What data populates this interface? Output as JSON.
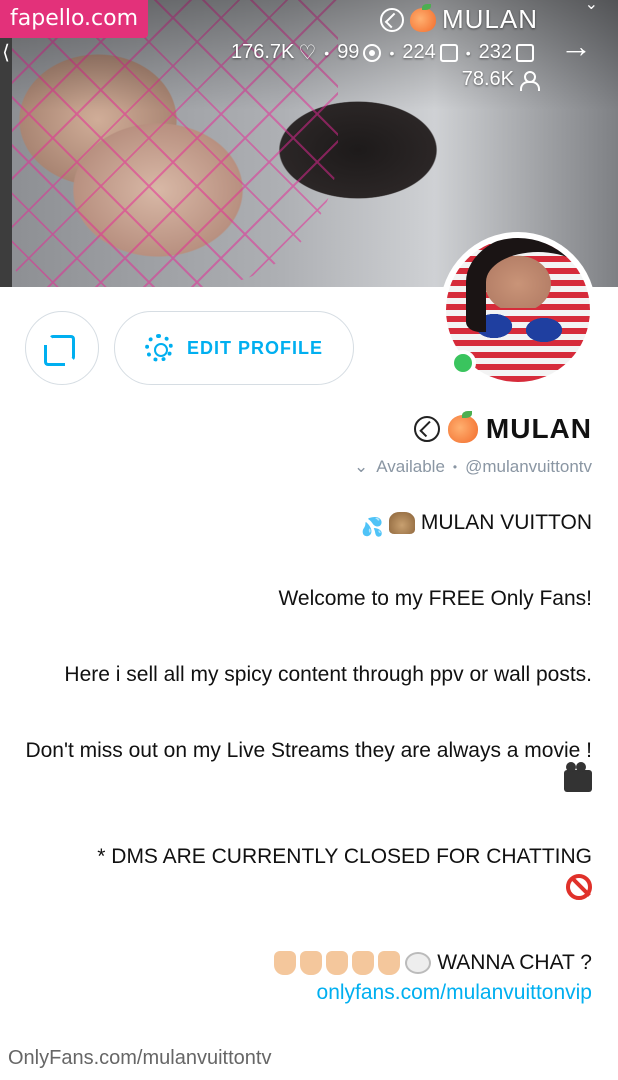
{
  "watermark": "fapello.com",
  "header": {
    "name": "MULAN",
    "stats": {
      "photos": "232",
      "videos": "224",
      "streams": "99",
      "likes": "176.7K"
    },
    "fans": "78.6K"
  },
  "actions": {
    "edit_profile_label": "EDIT PROFILE"
  },
  "profile": {
    "name": "MULAN",
    "handle": "@mulanvuittontv",
    "status": "Available"
  },
  "bio": {
    "line1": "MULAN VUITTON",
    "line2": "Welcome to my FREE Only Fans!",
    "line3": "Here i sell all my spicy content through ppv or wall posts.",
    "line4": "Don't miss out on my Live Streams they are always a movie !",
    "line5": "* DMS ARE CURRENTLY CLOSED FOR CHATTING",
    "line6": "WANNA CHAT ?",
    "link": "onlyfans.com/mulanvuittonvip"
  },
  "footer": {
    "url": "OnlyFans.com/mulanvuittontv"
  },
  "colors": {
    "accent": "#00aff0",
    "online": "#3ac45e",
    "watermark_bg": "#e3317a"
  },
  "icons": [
    "verified-icon",
    "peach-icon",
    "photo-icon",
    "video-icon",
    "live-icon",
    "heart-icon",
    "fans-icon",
    "back-arrow-icon",
    "gear-icon",
    "share-icon"
  ]
}
